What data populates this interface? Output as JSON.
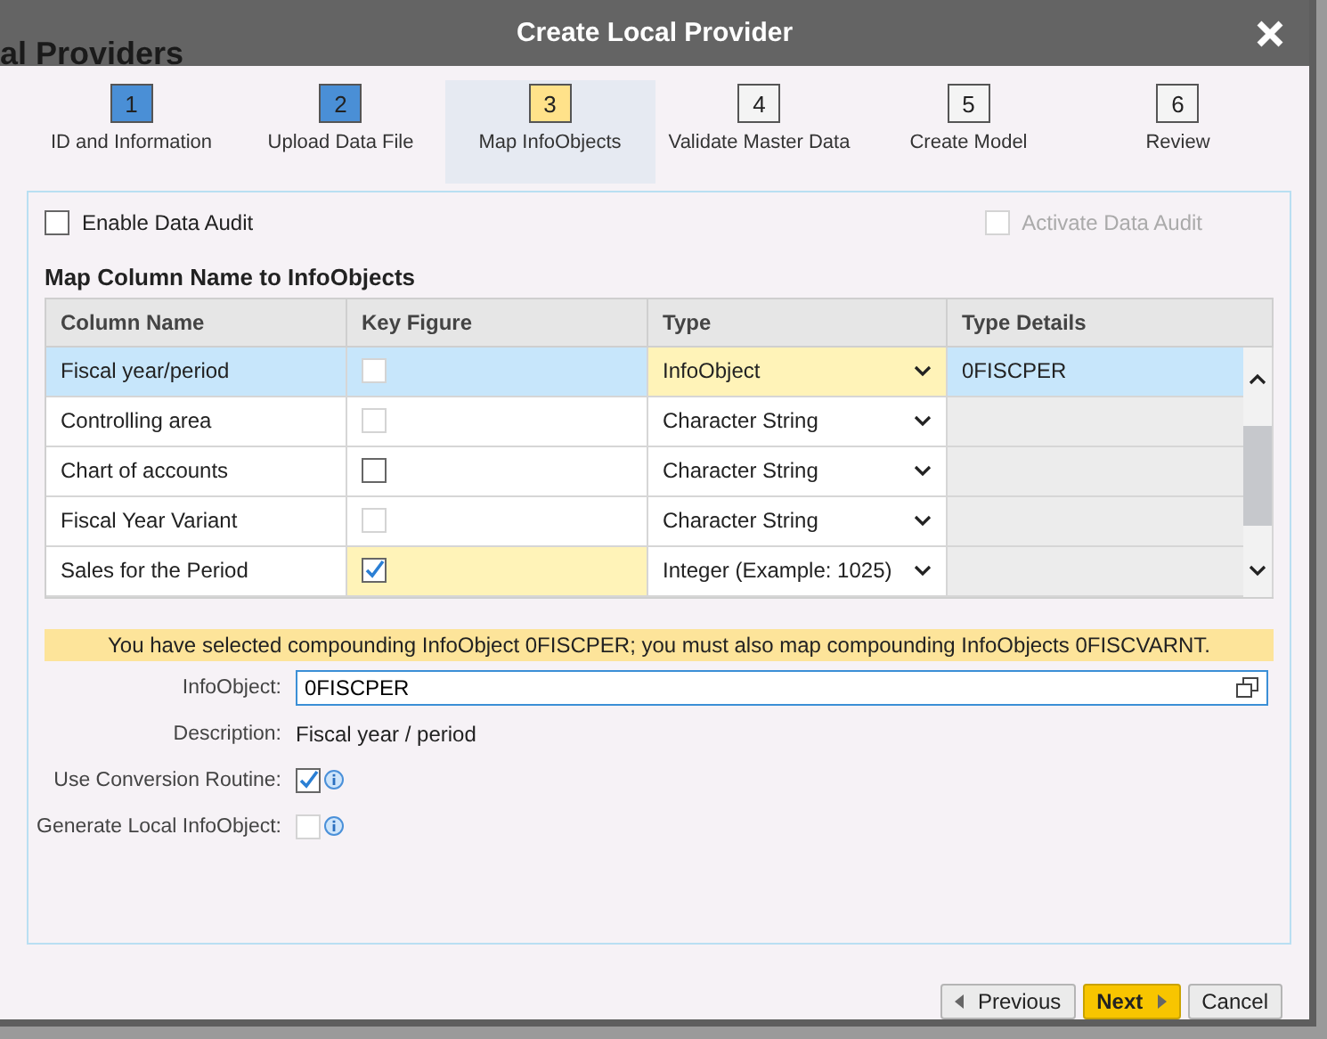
{
  "background_page": {
    "title": "al Providers"
  },
  "dialog": {
    "title": "Create Local Provider"
  },
  "steps": [
    {
      "number": "1",
      "label": "ID and Information",
      "kind": "done",
      "selected": false
    },
    {
      "number": "2",
      "label": "Upload Data File",
      "kind": "done",
      "selected": false
    },
    {
      "number": "3",
      "label": "Map InfoObjects",
      "kind": "current",
      "selected": true
    },
    {
      "number": "4",
      "label": "Validate Master Data",
      "kind": "todo",
      "selected": false
    },
    {
      "number": "5",
      "label": "Create Model",
      "kind": "todo",
      "selected": false
    },
    {
      "number": "6",
      "label": "Review",
      "kind": "todo",
      "selected": false
    }
  ],
  "enable_data_audit": {
    "label": "Enable Data Audit",
    "checked": false,
    "disabled": false
  },
  "activate_data_audit": {
    "label": "Activate Data Audit",
    "checked": false,
    "disabled": true
  },
  "section_title": "Map Column Name to InfoObjects",
  "table": {
    "columns": [
      "Column Name",
      "Key Figure",
      "Type",
      "Type Details"
    ],
    "rows": [
      {
        "name": "Fiscal year/period",
        "key_figure": {
          "checked": false,
          "disabled": true
        },
        "key_figure_highlighted": false,
        "type": "InfoObject",
        "type_highlighted": true,
        "type_details": "0FISCPER",
        "selected": true
      },
      {
        "name": "Controlling area",
        "key_figure": {
          "checked": false,
          "disabled": true
        },
        "key_figure_highlighted": false,
        "type": "Character String",
        "type_highlighted": false,
        "selected": false
      },
      {
        "name": "Chart of accounts",
        "key_figure": {
          "checked": false,
          "disabled": false
        },
        "key_figure_highlighted": false,
        "type": "Character String",
        "type_highlighted": false,
        "selected": false
      },
      {
        "name": "Fiscal Year Variant",
        "key_figure": {
          "checked": false,
          "disabled": true
        },
        "key_figure_highlighted": false,
        "type": "Character String",
        "type_highlighted": false,
        "selected": false
      },
      {
        "name": "Sales for the Period",
        "key_figure": {
          "checked": true,
          "disabled": false
        },
        "key_figure_highlighted": true,
        "type": "Integer (Example: 1025)",
        "type_highlighted": false,
        "selected": false
      }
    ]
  },
  "warning": "You have selected compounding InfoObject 0FISCPER; you must also map compounding InfoObjects 0FISCVARNT.",
  "details": {
    "infoobject_label": "InfoObject:",
    "infoobject_value": "0FISCPER",
    "description_label": "Description:",
    "description_value": "Fiscal year / period",
    "conversion": {
      "label": "Use Conversion Routine:",
      "checked": true,
      "disabled": false
    },
    "generate": {
      "label": "Generate Local InfoObject:",
      "checked": false,
      "disabled": true
    }
  },
  "buttons": [
    {
      "label": "Previous",
      "kind": "previous"
    },
    {
      "label": "Next",
      "kind": "next"
    },
    {
      "label": "Cancel",
      "kind": "cancel"
    }
  ]
}
